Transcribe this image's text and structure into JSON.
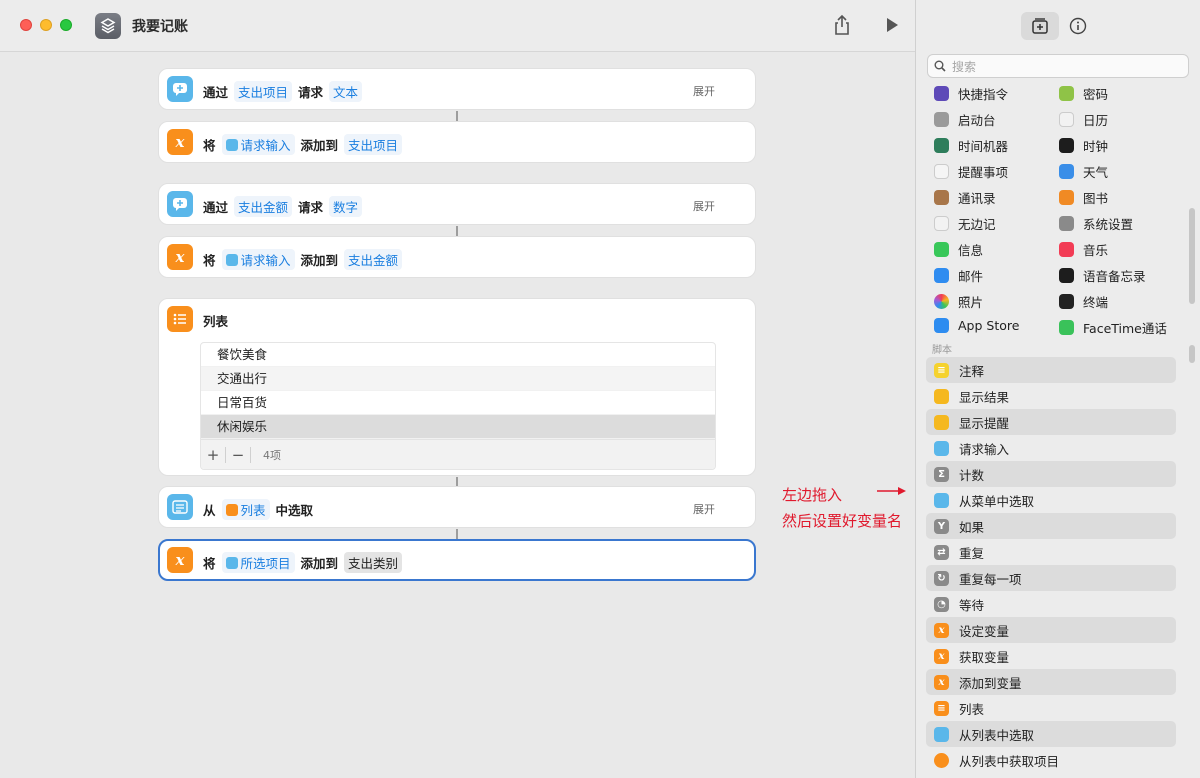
{
  "window": {
    "title": "我要记账"
  },
  "editor": {
    "actions": [
      {
        "type": "ask",
        "verb": "通过",
        "token1": "支出项目",
        "mid": "请求",
        "token2": "文本",
        "expand": "展开"
      },
      {
        "type": "add",
        "verb": "将",
        "token1": "请求输入",
        "mid": "添加到",
        "token2": "支出项目"
      },
      {
        "type": "ask",
        "verb": "通过",
        "token1": "支出金额",
        "mid": "请求",
        "token2": "数字",
        "expand": "展开"
      },
      {
        "type": "add",
        "verb": "将",
        "token1": "请求输入",
        "mid": "添加到",
        "token2": "支出金额"
      },
      {
        "type": "add",
        "verb": "将",
        "token1": "所选项目",
        "mid": "添加到",
        "token2": "支出类别"
      }
    ],
    "list_action": {
      "title": "列表",
      "items": [
        "餐饮美食",
        "交通出行",
        "日常百货",
        "休闲娱乐"
      ],
      "add_label": "+",
      "remove_label": "−",
      "count": "4项"
    },
    "choose_action": {
      "from": "从",
      "token": "列表",
      "suffix": "中选取",
      "expand": "展开"
    },
    "annotation": {
      "line1": "左边拖入",
      "line2": "然后设置好变量名",
      "color": "#e0192d"
    }
  },
  "panel": {
    "search_placeholder": "搜索",
    "apps": [
      {
        "label": "快捷指令",
        "color": "#5e4ab8"
      },
      {
        "label": "密码",
        "color": "#8fc347"
      },
      {
        "label": "启动台",
        "color": "#9a9a9a"
      },
      {
        "label": "日历",
        "color": "#f2f2f2"
      },
      {
        "label": "时间机器",
        "color": "#2e7d5b"
      },
      {
        "label": "时钟",
        "color": "#1d1d1d"
      },
      {
        "label": "提醒事项",
        "color": "#f5f5f5"
      },
      {
        "label": "天气",
        "color": "#3a8ee8"
      },
      {
        "label": "通讯录",
        "color": "#a8764a"
      },
      {
        "label": "图书",
        "color": "#f08a24"
      },
      {
        "label": "无边记",
        "color": "#f2f2f2"
      },
      {
        "label": "系统设置",
        "color": "#8a8a8a"
      },
      {
        "label": "信息",
        "color": "#38c759"
      },
      {
        "label": "音乐",
        "color": "#f23c55"
      },
      {
        "label": "邮件",
        "color": "#2f8cf0"
      },
      {
        "label": "语音备忘录",
        "color": "#1d1d1d"
      },
      {
        "label": "照片",
        "color": "#f2f2f2"
      },
      {
        "label": "终端",
        "color": "#222222"
      },
      {
        "label": "App Store",
        "color": "#2d8cf0"
      },
      {
        "label": "FaceTime通话",
        "color": "#3ac25a"
      }
    ],
    "section_label": "脚本",
    "scripts": [
      {
        "label": "注释",
        "color": "#f5d22e"
      },
      {
        "label": "显示结果",
        "color": "#f5b81f"
      },
      {
        "label": "显示提醒",
        "color": "#f5b81f"
      },
      {
        "label": "请求输入",
        "color": "#5ab7ea"
      },
      {
        "label": "计数",
        "color": "#8a8a8a"
      },
      {
        "label": "从菜单中选取",
        "color": "#5ab7ea"
      },
      {
        "label": "如果",
        "color": "#8a8a8a"
      },
      {
        "label": "重复",
        "color": "#8a8a8a"
      },
      {
        "label": "重复每一项",
        "color": "#8a8a8a"
      },
      {
        "label": "等待",
        "color": "#8a8a8a"
      },
      {
        "label": "设定变量",
        "color": "#f98f1c"
      },
      {
        "label": "获取变量",
        "color": "#f98f1c"
      },
      {
        "label": "添加到变量",
        "color": "#f98f1c"
      },
      {
        "label": "列表",
        "color": "#f98f1c"
      },
      {
        "label": "从列表中选取",
        "color": "#5ab7ea"
      },
      {
        "label": "从列表中获取项目",
        "color": "#f98f1c"
      }
    ]
  }
}
